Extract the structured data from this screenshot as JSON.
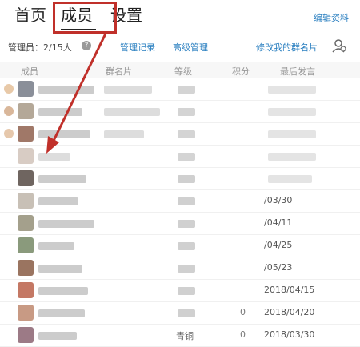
{
  "tabs": [
    {
      "label": "首页"
    },
    {
      "label": "成员"
    },
    {
      "label": "设置"
    }
  ],
  "edit_link": "编辑资料",
  "subbar": {
    "admins": "管理员：2/15人",
    "help": "?",
    "admin_log": "管理记录",
    "advanced": "高级管理",
    "edit_card": "修改我的群名片"
  },
  "table": {
    "headers": [
      "成员",
      "群名片",
      "等级",
      "积分",
      "最后发言"
    ]
  },
  "rows": [
    {
      "date": "",
      "points": "",
      "level": ""
    },
    {
      "date": "",
      "points": "",
      "level": ""
    },
    {
      "date": "",
      "points": "",
      "level": ""
    },
    {
      "date": "",
      "points": "",
      "level": ""
    },
    {
      "date": "",
      "points": "",
      "level": ""
    },
    {
      "date": "/03/30",
      "points": "",
      "level": ""
    },
    {
      "date": "/04/11",
      "points": "",
      "level": ""
    },
    {
      "date": "/04/25",
      "points": "",
      "level": ""
    },
    {
      "date": "/05/23",
      "points": "",
      "level": ""
    },
    {
      "date": "2018/04/15",
      "points": "",
      "level": ""
    },
    {
      "date": "2018/04/20",
      "points": "0",
      "level": ""
    },
    {
      "date": "2018/03/30",
      "points": "0",
      "level": "青铜"
    }
  ],
  "colors": {
    "link": "#2a7fc0",
    "highlight": "#c0302a"
  }
}
